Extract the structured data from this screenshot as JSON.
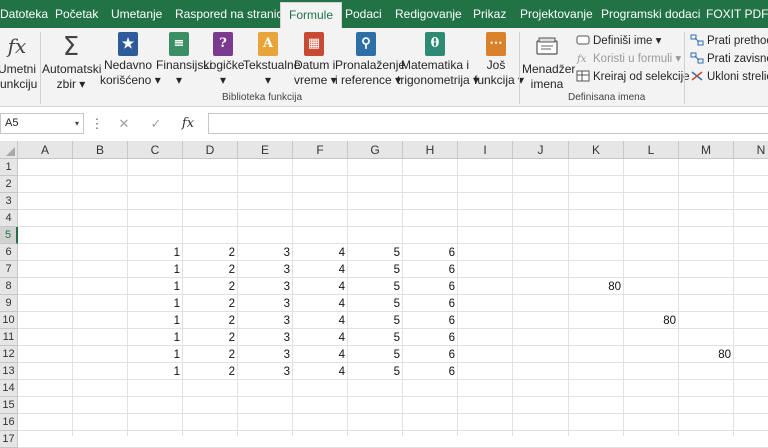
{
  "tabs": [
    {
      "label": "Datoteka",
      "active": false
    },
    {
      "label": "Početak",
      "active": false
    },
    {
      "label": "Umetanje",
      "active": false
    },
    {
      "label": "Raspored na stranici",
      "active": false
    },
    {
      "label": "Formule",
      "active": true
    },
    {
      "label": "Podaci",
      "active": false
    },
    {
      "label": "Redigovanje",
      "active": false
    },
    {
      "label": "Prikaz",
      "active": false
    },
    {
      "label": "Projektovanje",
      "active": false
    },
    {
      "label": "Programski dodaci",
      "active": false
    },
    {
      "label": "FOXIT PDF",
      "active": false
    }
  ],
  "ribbon": {
    "insert_function": {
      "line1": "Umetni",
      "line2": "funkciju"
    },
    "autosum": {
      "line1": "Automatski",
      "line2": "zbir ▾"
    },
    "recent": {
      "line1": "Nedavno",
      "line2": "korišćeno ▾"
    },
    "financial": {
      "line1": "Finansijski",
      "line2": "▾"
    },
    "logical": {
      "line1": "Logičke",
      "line2": "▾"
    },
    "text": {
      "line1": "Tekstualne",
      "line2": "▾"
    },
    "datetime": {
      "line1": "Datum i",
      "line2": "vreme ▾"
    },
    "lookup": {
      "line1": "Pronalaženje",
      "line2": "i reference ▾"
    },
    "math": {
      "line1": "Matematika i",
      "line2": "trigonometrija ▾"
    },
    "more": {
      "line1": "Još",
      "line2": "funkcija ▾"
    },
    "library_label": "Biblioteka funkcija",
    "name_manager": {
      "line1": "Menadžer",
      "line2": "imena"
    },
    "define_name": "Definiši ime ▾",
    "use_in_formula": "Koristi u formuli ▾",
    "create_from_selection": "Kreiraj od selekcije",
    "defined_names_label": "Definisana imena",
    "trace_precedents": "Prati prethodn",
    "trace_dependents": "Prati zavisne ć",
    "remove_arrows": "Ukloni strelice"
  },
  "formula_bar": {
    "name_box": "A5",
    "name_box_arrow": "▾",
    "dots": "⋮",
    "cancel_glyph": "✕",
    "enter_glyph": "✓",
    "fx_glyph": "fx",
    "formula": ""
  },
  "columns": [
    "A",
    "B",
    "C",
    "D",
    "E",
    "F",
    "G",
    "H",
    "I",
    "J",
    "K",
    "L",
    "M",
    "N"
  ],
  "rows": [
    "1",
    "2",
    "3",
    "4",
    "5",
    "6",
    "7",
    "8",
    "9",
    "10",
    "11",
    "12",
    "13",
    "14",
    "15",
    "16",
    "17"
  ],
  "selected_row": "5",
  "cells": [
    {
      "ref": "C6",
      "v": "1"
    },
    {
      "ref": "D6",
      "v": "2"
    },
    {
      "ref": "E6",
      "v": "3"
    },
    {
      "ref": "F6",
      "v": "4"
    },
    {
      "ref": "G6",
      "v": "5"
    },
    {
      "ref": "H6",
      "v": "6"
    },
    {
      "ref": "C7",
      "v": "1"
    },
    {
      "ref": "D7",
      "v": "2"
    },
    {
      "ref": "E7",
      "v": "3"
    },
    {
      "ref": "F7",
      "v": "4"
    },
    {
      "ref": "G7",
      "v": "5"
    },
    {
      "ref": "H7",
      "v": "6"
    },
    {
      "ref": "C8",
      "v": "1"
    },
    {
      "ref": "D8",
      "v": "2"
    },
    {
      "ref": "E8",
      "v": "3"
    },
    {
      "ref": "F8",
      "v": "4"
    },
    {
      "ref": "G8",
      "v": "5"
    },
    {
      "ref": "H8",
      "v": "6"
    },
    {
      "ref": "K8",
      "v": "80"
    },
    {
      "ref": "C9",
      "v": "1"
    },
    {
      "ref": "D9",
      "v": "2"
    },
    {
      "ref": "E9",
      "v": "3"
    },
    {
      "ref": "F9",
      "v": "4"
    },
    {
      "ref": "G9",
      "v": "5"
    },
    {
      "ref": "H9",
      "v": "6"
    },
    {
      "ref": "C10",
      "v": "1"
    },
    {
      "ref": "D10",
      "v": "2"
    },
    {
      "ref": "E10",
      "v": "3"
    },
    {
      "ref": "F10",
      "v": "4"
    },
    {
      "ref": "G10",
      "v": "5"
    },
    {
      "ref": "H10",
      "v": "6"
    },
    {
      "ref": "L10",
      "v": "80"
    },
    {
      "ref": "C11",
      "v": "1"
    },
    {
      "ref": "D11",
      "v": "2"
    },
    {
      "ref": "E11",
      "v": "3"
    },
    {
      "ref": "F11",
      "v": "4"
    },
    {
      "ref": "G11",
      "v": "5"
    },
    {
      "ref": "H11",
      "v": "6"
    },
    {
      "ref": "C12",
      "v": "1"
    },
    {
      "ref": "D12",
      "v": "2"
    },
    {
      "ref": "E12",
      "v": "3"
    },
    {
      "ref": "F12",
      "v": "4"
    },
    {
      "ref": "G12",
      "v": "5"
    },
    {
      "ref": "H12",
      "v": "6"
    },
    {
      "ref": "M12",
      "v": "80"
    },
    {
      "ref": "C13",
      "v": "1"
    },
    {
      "ref": "D13",
      "v": "2"
    },
    {
      "ref": "E13",
      "v": "3"
    },
    {
      "ref": "F13",
      "v": "4"
    },
    {
      "ref": "G13",
      "v": "5"
    },
    {
      "ref": "H13",
      "v": "6"
    }
  ]
}
